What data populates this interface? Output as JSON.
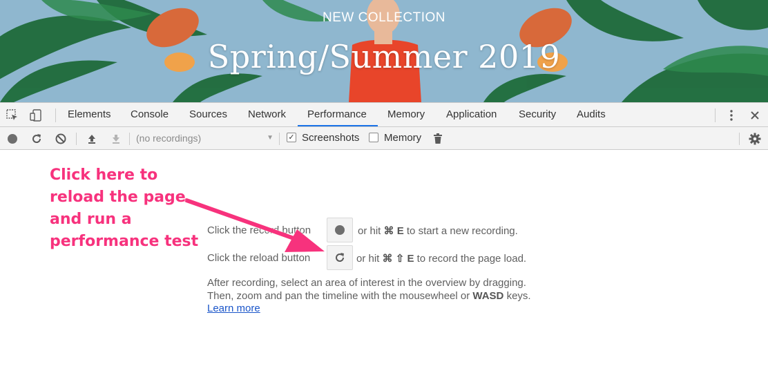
{
  "banner": {
    "eyebrow": "NEW COLLECTION",
    "title": "Spring/Summer 2019",
    "colors": {
      "sky": "#8fb7cf",
      "leaf": "#1f6b3a",
      "flower": "#d8693a",
      "shirt": "#e8452a"
    }
  },
  "devtools": {
    "icons": [
      "inspect-element-icon",
      "device-toolbar-icon",
      "more-vertical-icon",
      "close-icon"
    ],
    "tabs": [
      {
        "label": "Elements"
      },
      {
        "label": "Console"
      },
      {
        "label": "Sources"
      },
      {
        "label": "Network"
      },
      {
        "label": "Performance",
        "active": true
      },
      {
        "label": "Memory"
      },
      {
        "label": "Application"
      },
      {
        "label": "Security"
      },
      {
        "label": "Audits"
      }
    ],
    "accent": "#1a73e8"
  },
  "toolbar": {
    "icons": [
      "record-icon",
      "reload-icon",
      "clear-icon",
      "load-profile-icon",
      "save-profile-icon",
      "trash-icon",
      "settings-gear-icon"
    ],
    "recordings_placeholder": "(no recordings)",
    "screenshots_label": "Screenshots",
    "screenshots_checked": true,
    "memory_label": "Memory",
    "memory_checked": false
  },
  "landing": {
    "record_prefix": "Click the record button",
    "record_suffix_pre": "or hit",
    "record_shortcut": "⌘ E",
    "record_suffix_post": "to start a new recording.",
    "reload_prefix": "Click the reload button",
    "reload_suffix_pre": "or hit",
    "reload_shortcut_cmd": "⌘",
    "reload_shortcut_shift": "⇧",
    "reload_shortcut_key": "E",
    "reload_suffix_post": "to record the page load.",
    "hint_line1": "After recording, select an area of interest in the overview by dragging.",
    "hint_line2_pre": "Then, zoom and pan the timeline with the mousewheel or",
    "hint_line2_keys": "WASD",
    "hint_line2_post": "keys.",
    "learn_more": "Learn more"
  },
  "annotation": {
    "lines": [
      "Click here to",
      "reload the page",
      "and run a",
      "performance test"
    ],
    "color": "#f7327d"
  }
}
